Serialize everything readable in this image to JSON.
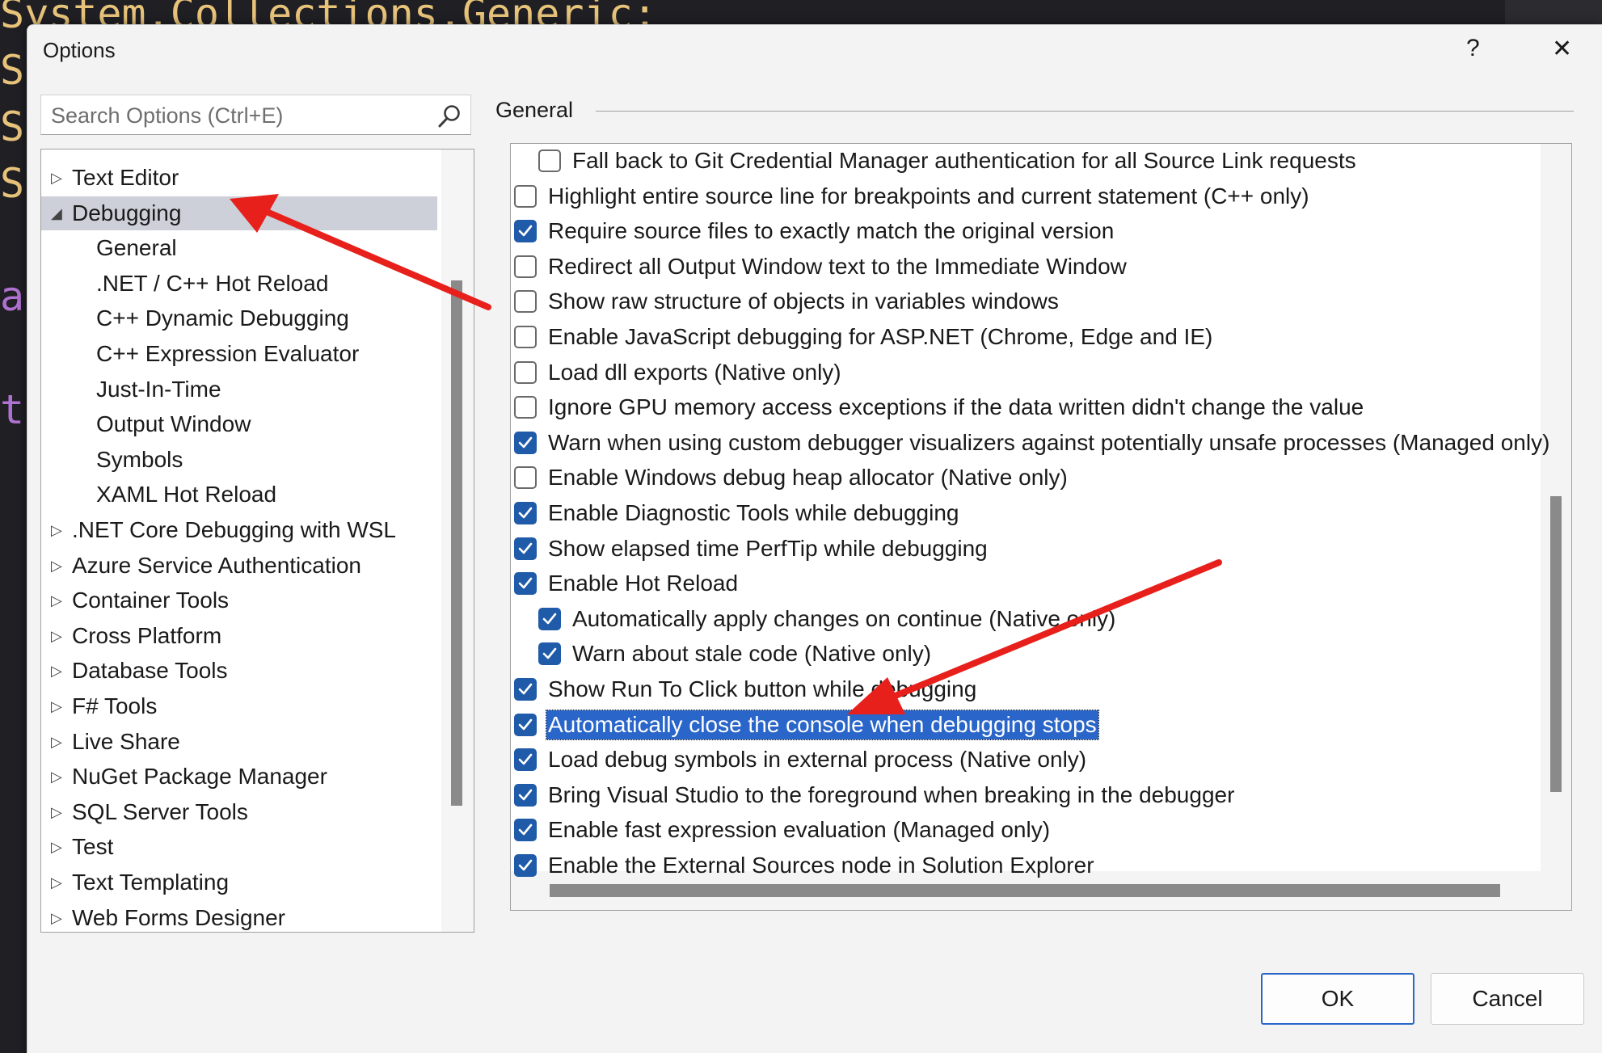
{
  "background_code": [
    {
      "text": "System.Collections.Generic;",
      "color": "#e8c37a"
    },
    {
      "text": "Sy",
      "color": "#e8c37a"
    },
    {
      "text": "Sy",
      "color": "#e8c37a"
    },
    {
      "text": "Sy",
      "color": "#e8c37a"
    },
    {
      "text": "",
      "color": "#e8c37a"
    },
    {
      "text": "ac",
      "color": "#b072d1"
    },
    {
      "text": "",
      "color": "#e8c37a"
    },
    {
      "text": "te",
      "color": "#b072d1"
    }
  ],
  "dialog": {
    "title": "Options",
    "help_label": "?",
    "close_label": "✕"
  },
  "search": {
    "placeholder": "Search Options (Ctrl+E)",
    "value": ""
  },
  "tree": {
    "items": [
      {
        "label": "Text Editor",
        "expander": "closed",
        "level": 0,
        "selected": false
      },
      {
        "label": "Debugging",
        "expander": "open",
        "level": 0,
        "selected": true
      },
      {
        "label": "General",
        "expander": "none",
        "level": 1,
        "selected": false
      },
      {
        "label": ".NET / C++ Hot Reload",
        "expander": "none",
        "level": 1,
        "selected": false
      },
      {
        "label": "C++ Dynamic Debugging",
        "expander": "none",
        "level": 1,
        "selected": false
      },
      {
        "label": "C++ Expression Evaluator",
        "expander": "none",
        "level": 1,
        "selected": false
      },
      {
        "label": "Just-In-Time",
        "expander": "none",
        "level": 1,
        "selected": false
      },
      {
        "label": "Output Window",
        "expander": "none",
        "level": 1,
        "selected": false
      },
      {
        "label": "Symbols",
        "expander": "none",
        "level": 1,
        "selected": false
      },
      {
        "label": "XAML Hot Reload",
        "expander": "none",
        "level": 1,
        "selected": false
      },
      {
        "label": ".NET Core Debugging with WSL",
        "expander": "closed",
        "level": 0,
        "selected": false
      },
      {
        "label": "Azure Service Authentication",
        "expander": "closed",
        "level": 0,
        "selected": false
      },
      {
        "label": "Container Tools",
        "expander": "closed",
        "level": 0,
        "selected": false
      },
      {
        "label": "Cross Platform",
        "expander": "closed",
        "level": 0,
        "selected": false
      },
      {
        "label": "Database Tools",
        "expander": "closed",
        "level": 0,
        "selected": false
      },
      {
        "label": "F# Tools",
        "expander": "closed",
        "level": 0,
        "selected": false
      },
      {
        "label": "Live Share",
        "expander": "closed",
        "level": 0,
        "selected": false
      },
      {
        "label": "NuGet Package Manager",
        "expander": "closed",
        "level": 0,
        "selected": false
      },
      {
        "label": "SQL Server Tools",
        "expander": "closed",
        "level": 0,
        "selected": false
      },
      {
        "label": "Test",
        "expander": "closed",
        "level": 0,
        "selected": false
      },
      {
        "label": "Text Templating",
        "expander": "closed",
        "level": 0,
        "selected": false
      },
      {
        "label": "Web Forms Designer",
        "expander": "closed",
        "level": 0,
        "selected": false
      }
    ]
  },
  "section": {
    "title": "General"
  },
  "options": [
    {
      "label": "Fall back to Git Credential Manager authentication for all Source Link requests",
      "checked": false,
      "indent": 1,
      "highlighted": false
    },
    {
      "label": "Highlight entire source line for breakpoints and current statement (C++ only)",
      "checked": false,
      "indent": 0,
      "highlighted": false
    },
    {
      "label": "Require source files to exactly match the original version",
      "checked": true,
      "indent": 0,
      "highlighted": false
    },
    {
      "label": "Redirect all Output Window text to the Immediate Window",
      "checked": false,
      "indent": 0,
      "highlighted": false
    },
    {
      "label": "Show raw structure of objects in variables windows",
      "checked": false,
      "indent": 0,
      "highlighted": false
    },
    {
      "label": "Enable JavaScript debugging for ASP.NET (Chrome, Edge and IE)",
      "checked": false,
      "indent": 0,
      "highlighted": false
    },
    {
      "label": "Load dll exports (Native only)",
      "checked": false,
      "indent": 0,
      "highlighted": false
    },
    {
      "label": "Ignore GPU memory access exceptions if the data written didn't change the value",
      "checked": false,
      "indent": 0,
      "highlighted": false
    },
    {
      "label": "Warn when using custom debugger visualizers against potentially unsafe processes (Managed only)",
      "checked": true,
      "indent": 0,
      "highlighted": false
    },
    {
      "label": "Enable Windows debug heap allocator (Native only)",
      "checked": false,
      "indent": 0,
      "highlighted": false
    },
    {
      "label": "Enable Diagnostic Tools while debugging",
      "checked": true,
      "indent": 0,
      "highlighted": false
    },
    {
      "label": "Show elapsed time PerfTip while debugging",
      "checked": true,
      "indent": 0,
      "highlighted": false
    },
    {
      "label": "Enable Hot Reload",
      "checked": true,
      "indent": 0,
      "highlighted": false
    },
    {
      "label": "Automatically apply changes on continue (Native only)",
      "checked": true,
      "indent": 1,
      "highlighted": false
    },
    {
      "label": "Warn about stale code (Native only)",
      "checked": true,
      "indent": 1,
      "highlighted": false
    },
    {
      "label": "Show Run To Click button while debugging",
      "checked": true,
      "indent": 0,
      "highlighted": false
    },
    {
      "label": "Automatically close the console when debugging stops",
      "checked": true,
      "indent": 0,
      "highlighted": true
    },
    {
      "label": "Load debug symbols in external process (Native only)",
      "checked": true,
      "indent": 0,
      "highlighted": false
    },
    {
      "label": "Bring Visual Studio to the foreground when breaking in the debugger",
      "checked": true,
      "indent": 0,
      "highlighted": false
    },
    {
      "label": "Enable fast expression evaluation (Managed only)",
      "checked": true,
      "indent": 0,
      "highlighted": false
    },
    {
      "label": "Enable the External Sources node in Solution Explorer",
      "checked": true,
      "indent": 0,
      "highlighted": false
    }
  ],
  "buttons": {
    "ok": "OK",
    "cancel": "Cancel"
  },
  "colors": {
    "accent": "#1f5ba9",
    "highlight": "#2a66c9",
    "annotation_arrow": "#e8201c",
    "tree_selected": "#cdcfd9"
  }
}
